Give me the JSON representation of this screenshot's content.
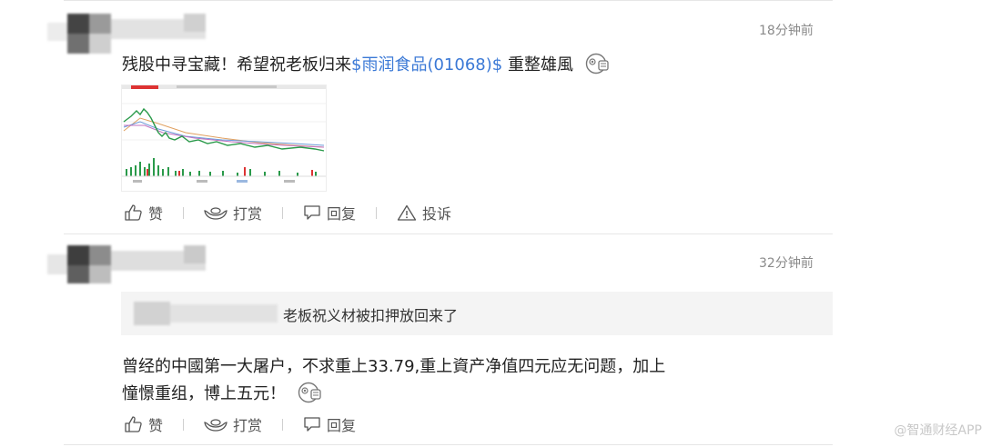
{
  "comments": [
    {
      "time": "18分钟前",
      "text_prefix": "残股中寻宝藏！希望祝老板归来",
      "stock_tag": "$雨润食品(01068)$",
      "text_suffix": " 重整雄風",
      "emoji": "laugh-emoji",
      "actions": {
        "like": "赞",
        "tip": "打赏",
        "reply": "回复",
        "report": "投诉"
      }
    },
    {
      "time": "32分钟前",
      "quote": "老板祝义材被扣押放回来了",
      "line1": "曾经的中國第一大屠户，不求重上33.79,重上資产净值四元应无问题，加上",
      "line2": "憧憬重组，博上五元！",
      "emoji": "laugh-emoji",
      "actions": {
        "like": "赞",
        "tip": "打赏",
        "reply": "回复"
      }
    }
  ],
  "watermark": "@智通财经APP",
  "colors": {
    "link": "#3b79d6",
    "divider": "#e6e6e6",
    "quote_bg": "#f4f4f4"
  }
}
